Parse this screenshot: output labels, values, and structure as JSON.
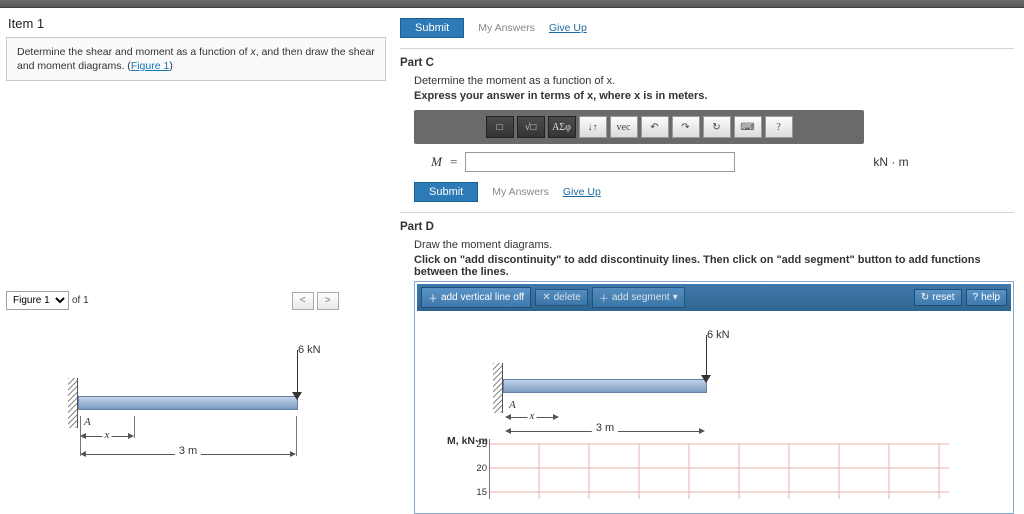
{
  "item": {
    "title": "Item 1",
    "description_prefix": "Determine the shear and moment as a function of ",
    "description_var": "x",
    "description_suffix": ", and then draw the shear and moment diagrams. (",
    "figure_link": "Figure 1",
    "description_close": ")"
  },
  "figure_controls": {
    "select_label": "Figure 1",
    "of_label": "of 1"
  },
  "figure": {
    "force_label": "6 kN",
    "point_A": "A",
    "dim_x": "x",
    "dim_span": "3 m"
  },
  "actions": {
    "submit": "Submit",
    "my_answers": "My Answers",
    "give_up": "Give Up"
  },
  "partC": {
    "title": "Part C",
    "prompt1": "Determine the moment as a function of x.",
    "prompt2": "Express your answer in terms of x, where x is in meters.",
    "var": "M",
    "eq": "=",
    "unit": "kN · m",
    "value": ""
  },
  "toolbar": {
    "b1": "□",
    "b2": "√□",
    "b3": "ΑΣφ",
    "b4": "↓↑",
    "b5": "vec",
    "b6": "↶",
    "b7": "↷",
    "b8": "↻",
    "b9": "⌨",
    "b10": "?"
  },
  "partD": {
    "title": "Part D",
    "prompt1": "Draw the moment diagrams.",
    "prompt2": "Click on \"add discontinuity\" to add discontinuity lines. Then click on \"add segment\" button to add functions between the lines.",
    "tool_add_vert": "add vertical line off",
    "tool_delete": "delete",
    "tool_add_seg": "add segment",
    "tool_reset": "reset",
    "tool_help": "help",
    "plot_ylabel": "M, kN·m"
  },
  "chart_data": {
    "type": "line",
    "title": "",
    "xlabel": "",
    "ylabel": "M, kN·m",
    "ylim": [
      15,
      25
    ],
    "yticks": [
      25,
      20,
      15
    ],
    "grid": true,
    "series": []
  }
}
